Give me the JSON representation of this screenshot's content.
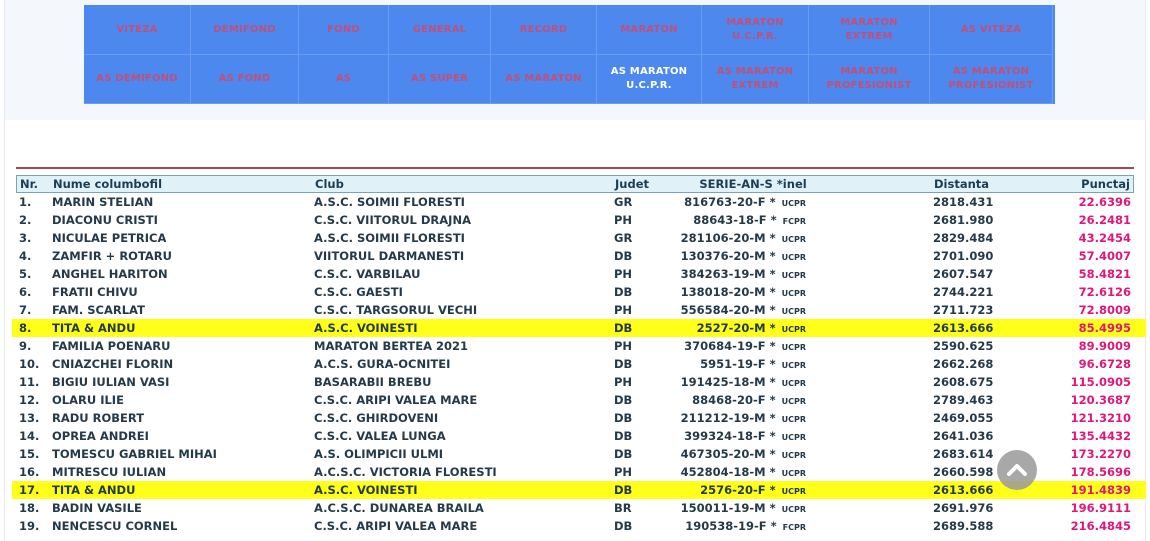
{
  "nav": {
    "row1": [
      {
        "label": "VITEZA",
        "active": false
      },
      {
        "label": "DEMIFOND",
        "active": false
      },
      {
        "label": "FOND",
        "active": false
      },
      {
        "label": "GENERAL",
        "active": false
      },
      {
        "label": "RECORD",
        "active": false
      },
      {
        "label": "MARATON",
        "active": false
      },
      {
        "label": "MARATON\nU.C.P.R.",
        "active": false
      },
      {
        "label": "MARATON\nEXTREM",
        "active": false
      },
      {
        "label": "AS VITEZA",
        "active": false
      }
    ],
    "row2": [
      {
        "label": "AS DEMIFOND",
        "active": false
      },
      {
        "label": "AS FOND",
        "active": false
      },
      {
        "label": "AS",
        "active": false
      },
      {
        "label": "AS SUPER",
        "active": false
      },
      {
        "label": "AS MARATON",
        "active": false
      },
      {
        "label": "AS MARATON\nU.C.P.R.",
        "active": true
      },
      {
        "label": "AS MARATON\nEXTREM",
        "active": false
      },
      {
        "label": "MARATON\nPROFESIONIST",
        "active": false
      },
      {
        "label": "AS MARATON\nPROFESIONIST",
        "active": false
      }
    ]
  },
  "table": {
    "headers": {
      "nr": "Nr.",
      "name": "Nume columbofil",
      "club": "Club",
      "judet": "Judet",
      "serie": "SERIE-AN-S *inel",
      "dist": "Distanta",
      "punct": "Punctaj"
    },
    "rows": [
      {
        "nr": "1.",
        "name": "MARIN STELIAN",
        "club": "A.S.C. SOIMII FLORESTI",
        "judet": "GR",
        "serie": "816763-20-F * ",
        "fed": "UCPR",
        "dist": "2818.431",
        "punct": "22.6396",
        "hl": false
      },
      {
        "nr": "2.",
        "name": "DIACONU CRISTI",
        "club": "C.S.C. VIITORUL DRAJNA",
        "judet": "PH",
        "serie": "88643-18-F * ",
        "fed": "FCPR",
        "dist": "2681.980",
        "punct": "26.2481",
        "hl": false
      },
      {
        "nr": "3.",
        "name": "NICULAE PETRICA",
        "club": "A.S.C. SOIMII FLORESTI",
        "judet": "GR",
        "serie": "281106-20-M * ",
        "fed": "UCPR",
        "dist": "2829.484",
        "punct": "43.2454",
        "hl": false
      },
      {
        "nr": "4.",
        "name": "ZAMFIR + ROTARU",
        "club": "VIITORUL DARMANESTI",
        "judet": "DB",
        "serie": "130376-20-M * ",
        "fed": "UCPR",
        "dist": "2701.090",
        "punct": "57.4007",
        "hl": false
      },
      {
        "nr": "5.",
        "name": "ANGHEL HARITON",
        "club": "C.S.C. VARBILAU",
        "judet": "PH",
        "serie": "384263-19-M * ",
        "fed": "UCPR",
        "dist": "2607.547",
        "punct": "58.4821",
        "hl": false
      },
      {
        "nr": "6.",
        "name": "FRATII CHIVU",
        "club": "C.S.C. GAESTI",
        "judet": "DB",
        "serie": "138018-20-M * ",
        "fed": "UCPR",
        "dist": "2744.221",
        "punct": "72.6126",
        "hl": false
      },
      {
        "nr": "7.",
        "name": "FAM. SCARLAT",
        "club": "C.S.C. TARGSORUL VECHI",
        "judet": "PH",
        "serie": "556584-20-M * ",
        "fed": "UCPR",
        "dist": "2711.723",
        "punct": "72.8009",
        "hl": false
      },
      {
        "nr": "8.",
        "name": "TITA & ANDU",
        "club": "A.S.C. VOINESTI",
        "judet": "DB",
        "serie": "2527-20-M * ",
        "fed": "UCPR",
        "dist": "2613.666",
        "punct": "85.4995",
        "hl": true
      },
      {
        "nr": "9.",
        "name": "FAMILIA POENARU",
        "club": "MARATON BERTEA 2021",
        "judet": "PH",
        "serie": "370684-19-F * ",
        "fed": "UCPR",
        "dist": "2590.625",
        "punct": "89.9009",
        "hl": false
      },
      {
        "nr": "10.",
        "name": "CNIAZCHEI FLORIN",
        "club": "A.C.S. GURA-OCNITEI",
        "judet": "DB",
        "serie": "5951-19-F * ",
        "fed": "UCPR",
        "dist": "2662.268",
        "punct": "96.6728",
        "hl": false
      },
      {
        "nr": "11.",
        "name": "BIGIU IULIAN VASI",
        "club": "BASARABII BREBU",
        "judet": "PH",
        "serie": "191425-18-M * ",
        "fed": "UCPR",
        "dist": "2608.675",
        "punct": "115.0905",
        "hl": false
      },
      {
        "nr": "12.",
        "name": "OLARU ILIE",
        "club": "C.S.C. ARIPI VALEA MARE",
        "judet": "DB",
        "serie": "88468-20-F * ",
        "fed": "UCPR",
        "dist": "2789.463",
        "punct": "120.3687",
        "hl": false
      },
      {
        "nr": "13.",
        "name": "RADU ROBERT",
        "club": "C.S.C. GHIRDOVENI",
        "judet": "DB",
        "serie": "211212-19-M * ",
        "fed": "UCPR",
        "dist": "2469.055",
        "punct": "121.3210",
        "hl": false
      },
      {
        "nr": "14.",
        "name": "OPREA ANDREI",
        "club": "C.S.C. VALEA LUNGA",
        "judet": "DB",
        "serie": "399324-18-F * ",
        "fed": "UCPR",
        "dist": "2641.036",
        "punct": "135.4432",
        "hl": false
      },
      {
        "nr": "15.",
        "name": "TOMESCU GABRIEL MIHAI",
        "club": "A.S. OLIMPICII ULMI",
        "judet": "DB",
        "serie": "467305-20-M * ",
        "fed": "UCPR",
        "dist": "2683.614",
        "punct": "173.2270",
        "hl": false
      },
      {
        "nr": "16.",
        "name": "MITRESCU IULIAN",
        "club": "A.C.S.C. VICTORIA FLORESTI",
        "judet": "PH",
        "serie": "452804-18-M * ",
        "fed": "UCPR",
        "dist": "2660.598",
        "punct": "178.5696",
        "hl": false
      },
      {
        "nr": "17.",
        "name": "TITA & ANDU",
        "club": "A.S.C. VOINESTI",
        "judet": "DB",
        "serie": "2576-20-F * ",
        "fed": "UCPR",
        "dist": "2613.666",
        "punct": "191.4839",
        "hl": true
      },
      {
        "nr": "18.",
        "name": "BADIN VASILE",
        "club": "A.C.S.C. DUNAREA BRAILA",
        "judet": "BR",
        "serie": "150011-19-M * ",
        "fed": "UCPR",
        "dist": "2691.976",
        "punct": "196.9111",
        "hl": false
      },
      {
        "nr": "19.",
        "name": "NENCESCU CORNEL",
        "club": "C.S.C. ARIPI VALEA MARE",
        "judet": "DB",
        "serie": "190538-19-F * ",
        "fed": "FCPR",
        "dist": "2689.588",
        "punct": "216.4845",
        "hl": false
      }
    ]
  },
  "colors": {
    "nav_bg": "#4d88ee",
    "nav_text": "#c0507a",
    "nav_active_text": "#ffffff",
    "highlight": "#ffff1a",
    "punctaj": "#e0177a",
    "rule": "#a24a4a"
  },
  "icons": {
    "scroll_top": "chevron-up-icon"
  }
}
